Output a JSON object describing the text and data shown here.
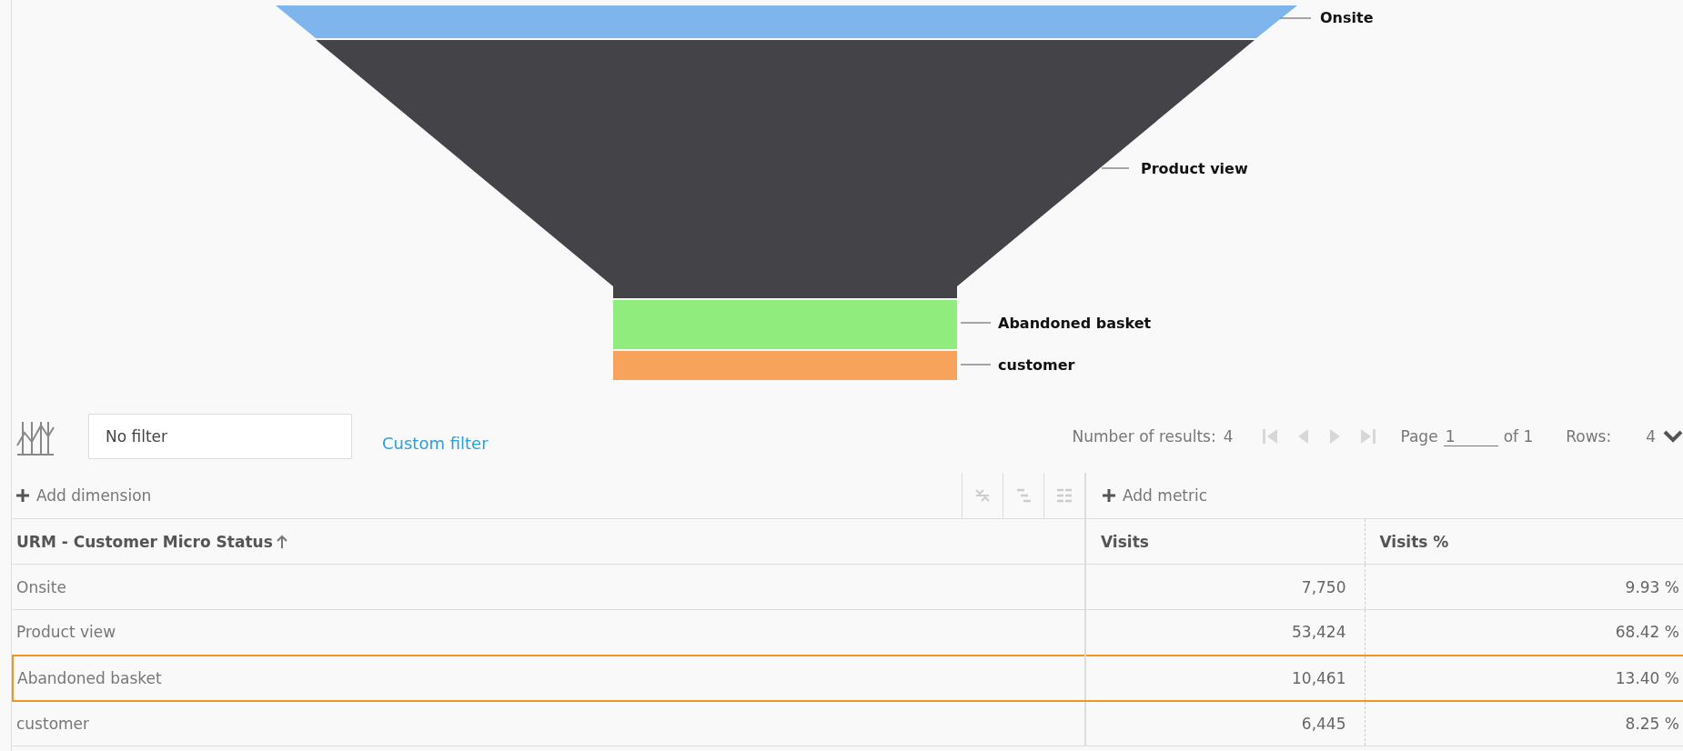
{
  "funnel": {
    "stages": [
      {
        "name": "Onsite",
        "color": "#7eb5ec"
      },
      {
        "name": "Product view",
        "color": "#434348"
      },
      {
        "name": "Abandoned basket",
        "color": "#90ed7d"
      },
      {
        "name": "customer",
        "color": "#f7a35c"
      }
    ]
  },
  "toolbar": {
    "filter": {
      "value": "No filter"
    },
    "custom_filter": "Custom filter",
    "results_label": "Number of results:",
    "results_count": "4",
    "pager": [
      {
        "kind": "first",
        "disabled": true
      },
      {
        "kind": "prev",
        "disabled": true
      },
      {
        "kind": "next",
        "disabled": true
      },
      {
        "kind": "last",
        "disabled": true
      }
    ],
    "page_label": "Page",
    "page_value": "1",
    "page_of": "of 1",
    "rows_label": "Rows:",
    "rows_value": "4"
  },
  "table": {
    "add_dimension": "Add dimension",
    "add_metric": "Add metric",
    "columns": [
      "URM - Customer Micro Status",
      "Visits",
      "Visits %"
    ],
    "rows": [
      {
        "cells": [
          "Onsite",
          "7,750",
          "9.93 %"
        ],
        "selected": false
      },
      {
        "cells": [
          "Product view",
          "53,424",
          "68.42 %"
        ],
        "selected": false
      },
      {
        "cells": [
          "Abandoned basket",
          "10,461",
          "13.40 %"
        ],
        "selected": true
      },
      {
        "cells": [
          "customer",
          "6,445",
          "8.25 %"
        ],
        "selected": false
      }
    ]
  }
}
